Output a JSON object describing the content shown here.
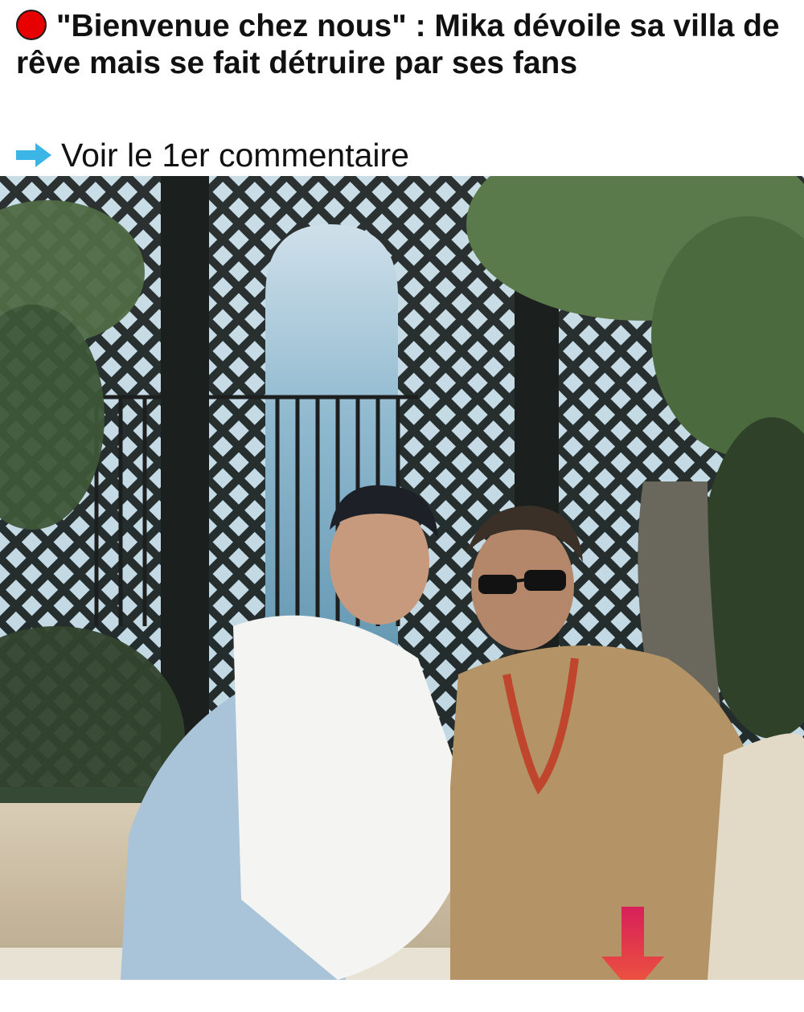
{
  "article": {
    "headline": "\"Bienvenue chez nous\" : Mika dévoile sa villa de rêve mais se fait détruire par ses fans",
    "comment_link": "Voir le 1er commentaire"
  },
  "icons": {
    "bullet": "red-circle-icon",
    "link": "right-arrow-icon",
    "scroll": "down-arrow-icon"
  },
  "colors": {
    "bullet_red": "#e60000",
    "link_arrow": "#3bb4e6",
    "scroll_arrow": "#e2304f"
  }
}
